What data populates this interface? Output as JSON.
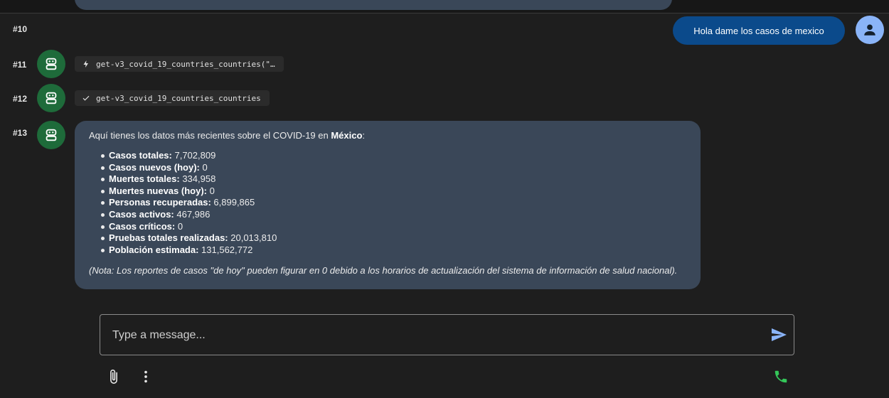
{
  "messages": {
    "m10": {
      "number": "#10",
      "text": "Hola dame los casos de mexico"
    },
    "m11": {
      "number": "#11",
      "tool_call": "get-v3_covid_19_countries_countries(\"…"
    },
    "m12": {
      "number": "#12",
      "tool_result": "get-v3_covid_19_countries_countries"
    },
    "m13": {
      "number": "#13",
      "intro": "Aquí tienes los datos más recientes sobre el COVID-19 en ",
      "intro_bold": "México",
      "intro_end": ":",
      "items": [
        {
          "label": "Casos totales:",
          "value": " 7,702,809"
        },
        {
          "label": "Casos nuevos (hoy):",
          "value": " 0"
        },
        {
          "label": "Muertes totales:",
          "value": " 334,958"
        },
        {
          "label": "Muertes nuevas (hoy):",
          "value": " 0"
        },
        {
          "label": "Personas recuperadas:",
          "value": " 6,899,865"
        },
        {
          "label": "Casos activos:",
          "value": " 467,986"
        },
        {
          "label": "Casos críticos:",
          "value": " 0"
        },
        {
          "label": "Pruebas totales realizadas:",
          "value": " 20,013,810"
        },
        {
          "label": "Población estimada:",
          "value": " 131,562,772"
        }
      ],
      "note": "(Nota: Los reportes de casos \"de hoy\" pueden figurar en 0 debido a los horarios de actualización del sistema de información de salud nacional)."
    }
  },
  "composer": {
    "placeholder": "Type a message..."
  },
  "icons": {
    "bot": "robot-icon",
    "user": "person-icon",
    "tool_call": "bolt-icon",
    "tool_result": "check-icon",
    "send": "send-icon",
    "attach": "paperclip-icon",
    "more": "more-vertical-icon",
    "call": "phone-icon"
  },
  "colors": {
    "background": "#1e1e1e",
    "bot_bubble": "#3a4758",
    "user_bubble": "#0b4a8b",
    "bot_avatar": "#1e6b3a",
    "user_avatar": "#8ab4f8",
    "send": "#8ab4f8",
    "call": "#34c759"
  }
}
